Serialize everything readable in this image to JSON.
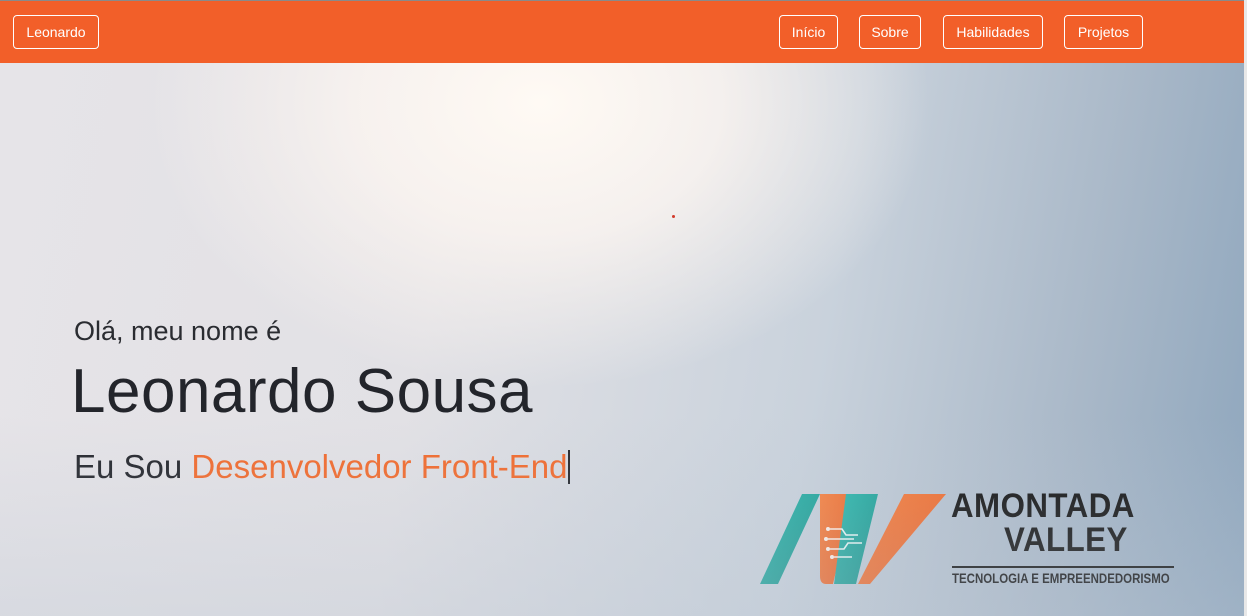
{
  "nav": {
    "brand": "Leonardo",
    "items": [
      {
        "label": "Início"
      },
      {
        "label": "Sobre"
      },
      {
        "label": "Habilidades"
      },
      {
        "label": "Projetos"
      }
    ]
  },
  "hero": {
    "greeting": "Olá, meu nome é",
    "name": "Leonardo Sousa",
    "role_prefix": "Eu Sou ",
    "role_highlight": "Desenvolvedor Front-End"
  },
  "logo": {
    "line1": "AMONTADA",
    "line2": "VALLEY",
    "tagline": "TECNOLOGIA E EMPREENDEDORISMO"
  },
  "colors": {
    "brand_orange": "#f25f29",
    "accent_orange": "#f26a2c",
    "logo_teal": "#1aa39a",
    "text_dark": "#23252b"
  }
}
